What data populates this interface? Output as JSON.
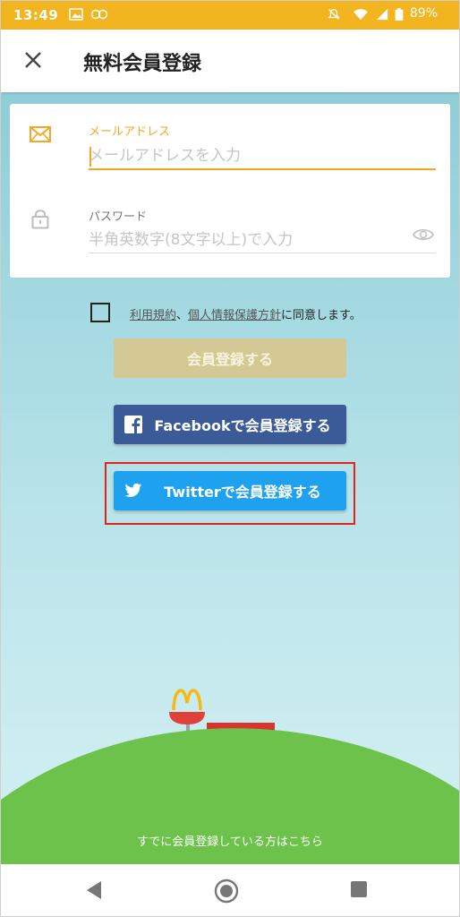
{
  "status_bar": {
    "time": "13:49",
    "battery": "89%"
  },
  "app_bar": {
    "title": "無料会員登録"
  },
  "form": {
    "email_label": "メールアドレス",
    "email_placeholder": "メールアドレスを入力",
    "password_label": "パスワード",
    "password_placeholder": "半角英数字(8文字以上)で入力"
  },
  "agreement": {
    "terms_link": "利用規約",
    "separator": "、",
    "privacy_link": "個人情報保護方針",
    "suffix": "に同意します。"
  },
  "buttons": {
    "register": "会員登録する",
    "facebook": "Facebookで会員登録する",
    "twitter": "Twitterで会員登録する"
  },
  "footer_link": "すでに会員登録している方はこちら",
  "colors": {
    "status_bar": "#f2b51f",
    "accent": "#f5a623",
    "facebook": "#3b5b98",
    "twitter": "#1ea1ef",
    "register_disabled": "#d4c995",
    "highlight": "#e2231a"
  },
  "icons": [
    "image-icon",
    "bluetooth-tag-icon",
    "mute-icon",
    "wifi-icon",
    "signal-icon",
    "battery-icon",
    "close-icon",
    "mail-icon",
    "lock-icon",
    "eye-icon",
    "facebook-icon",
    "twitter-icon",
    "back-icon",
    "home-icon",
    "recent-apps-icon"
  ]
}
